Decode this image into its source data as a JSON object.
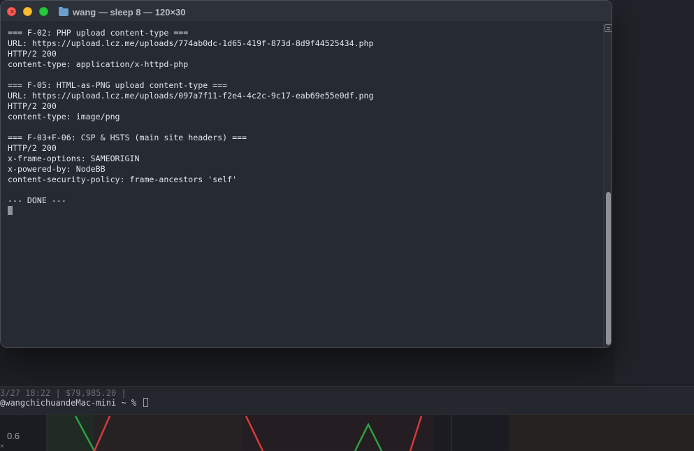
{
  "window": {
    "title": "wang — sleep 8 — 120×30"
  },
  "terminal": {
    "lines": [
      "=== F-02: PHP upload content-type ===",
      "URL: https://upload.lcz.me/uploads/774ab0dc-1d65-419f-873d-8d9f44525434.php",
      "HTTP/2 200",
      "content-type: application/x-httpd-php",
      "",
      "=== F-05: HTML-as-PNG upload content-type ===",
      "URL: https://upload.lcz.me/uploads/097a7f11-f2e4-4c2c-9c17-eab69e55e0df.png",
      "HTTP/2 200",
      "content-type: image/png",
      "",
      "=== F-03+F-06: CSP & HSTS (main site headers) ===",
      "HTTP/2 200",
      "x-frame-options: SAMEORIGIN",
      "x-powered-by: NodeBB",
      "content-security-policy: frame-ancestors 'self'",
      "",
      "--- DONE ---"
    ]
  },
  "background_terminal": {
    "line1": "3/27 18:22 | $79,985.20 |",
    "line2": "@wangchichuandeMac-mini ~ % "
  },
  "chart": {
    "tick_label": "0.6",
    "x_mark": "×",
    "up_color": "#2ea043",
    "down_color": "#d73a3a"
  },
  "colors": {
    "close": "#fe5f57",
    "minimize": "#febc2e",
    "maximize": "#28c840",
    "terminal_bg": "#262a33",
    "terminal_fg": "#e3e5e9"
  }
}
